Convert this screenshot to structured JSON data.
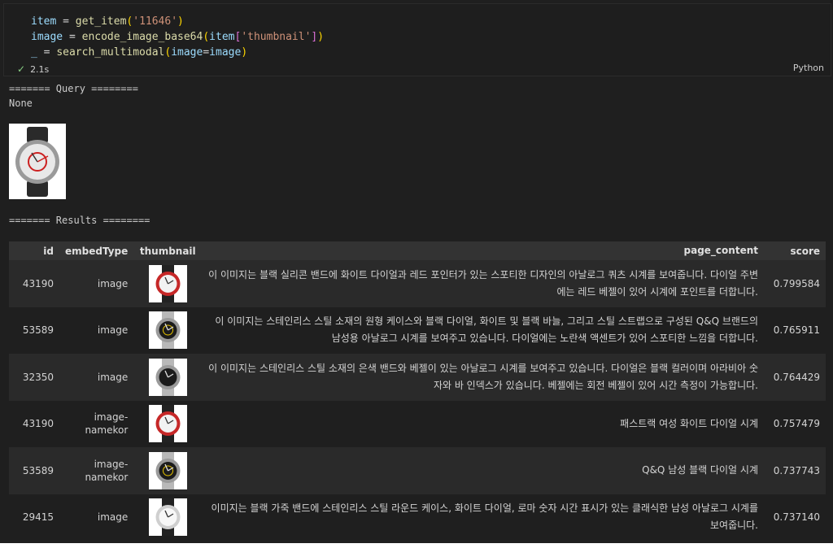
{
  "cell": {
    "code_lines": [
      {
        "parts": [
          [
            "var",
            "item"
          ],
          [
            "op",
            " = "
          ],
          [
            "fn",
            "get_item"
          ],
          [
            "brk1",
            "("
          ],
          [
            "str",
            "'11646'"
          ],
          [
            "brk1",
            ")"
          ]
        ]
      },
      {
        "parts": [
          [
            "var",
            "image"
          ],
          [
            "op",
            " = "
          ],
          [
            "fn",
            "encode_image_base64"
          ],
          [
            "brk1",
            "("
          ],
          [
            "var",
            "item"
          ],
          [
            "brk2",
            "["
          ],
          [
            "str",
            "'thumbnail'"
          ],
          [
            "brk2",
            "]"
          ],
          [
            "brk1",
            ")"
          ]
        ]
      },
      {
        "parts": [
          [
            "var",
            "_"
          ],
          [
            "op",
            " = "
          ],
          [
            "fn",
            "search_multimodal"
          ],
          [
            "brk1",
            "("
          ],
          [
            "var",
            "image"
          ],
          [
            "op",
            "="
          ],
          [
            "var",
            "image"
          ],
          [
            "brk1",
            ")"
          ]
        ]
      }
    ],
    "exec_time": "2.1s",
    "language": "Python"
  },
  "output": {
    "query_header": "======= Query ========",
    "query_value": "None",
    "results_header": "======= Results ========"
  },
  "table": {
    "headers": [
      "id",
      "embedType",
      "thumbnail",
      "page_content",
      "score"
    ],
    "rows": [
      {
        "id": "43190",
        "embedType": "image",
        "page_content": "이 이미지는 블랙 실리콘 밴드에 화이트 다이얼과 레드 포인터가 있는 스포티한 디자인의 아날로그 쿼츠 시계를 보여줍니다. 다이얼 주변에는 레드 베젤이 있어 시계에 포인트를 더합니다.",
        "score": "0.799584",
        "thumb": "red-watch"
      },
      {
        "id": "53589",
        "embedType": "image",
        "page_content": "이 이미지는 스테인리스 스틸 소재의 원형 케이스와 블랙 다이얼, 화이트 및 블랙 바늘, 그리고 스틸 스트랩으로 구성된 Q&Q 브랜드의 남성용 아날로그 시계를 보여주고 있습니다. 다이얼에는 노란색 액센트가 있어 스포티한 느낌을 더합니다.",
        "score": "0.765911",
        "thumb": "steel-watch"
      },
      {
        "id": "32350",
        "embedType": "image",
        "page_content": "이 이미지는 스테인리스 스틸 소재의 은색 밴드와 베젤이 있는 아날로그 시계를 보여주고 있습니다. 다이얼은 블랙 컬러이며 아라비아 숫자와 바 인덱스가 있습니다. 베젤에는 회전 베젤이 있어 시간 측정이 가능합니다.",
        "score": "0.764429",
        "thumb": "silver-watch"
      },
      {
        "id": "43190",
        "embedType": "image-namekor",
        "page_content": "패스트랙 여성 화이트 다이얼 시계",
        "score": "0.757479",
        "thumb": "red-watch"
      },
      {
        "id": "53589",
        "embedType": "image-namekor",
        "page_content": "Q&Q 남성 블랙 다이얼 시계",
        "score": "0.737743",
        "thumb": "steel-watch"
      },
      {
        "id": "29415",
        "embedType": "image",
        "page_content": "이미지는 블랙 가죽 밴드에 스테인리스 스틸 라운드 케이스, 화이트 다이얼, 로마 숫자 시간 표시가 있는 클래식한 남성 아날로그 시계를 보여줍니다.",
        "score": "0.737140",
        "thumb": "classic-watch"
      }
    ]
  },
  "colors": {
    "background": "#1f1f1f",
    "check": "#89d185",
    "header_row": "#333333"
  }
}
